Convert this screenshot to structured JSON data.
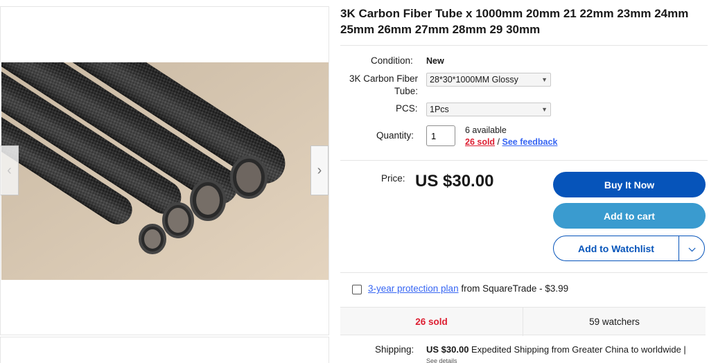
{
  "title": "3K Carbon Fiber Tube x 1000mm 20mm 21 22mm 23mm 24mm 25mm 26mm 27mm 28mm 29 30mm",
  "gallery": {
    "prev_icon": "chevron-left-icon",
    "next_icon": "chevron-right-icon",
    "prev": "‹",
    "next": "›"
  },
  "condition": {
    "label": "Condition:",
    "value": "New"
  },
  "variation": {
    "label_line1": "3K Carbon Fiber",
    "label_line2": "Tube:",
    "selected": "28*30*1000MM Glossy"
  },
  "pcs": {
    "label": "PCS:",
    "selected": "1Pcs"
  },
  "quantity": {
    "label": "Quantity:",
    "value": "1",
    "available": "6 available",
    "sold": "26 sold",
    "separator": " / ",
    "feedback": "See feedback"
  },
  "price": {
    "label": "Price:",
    "value": "US $30.00"
  },
  "buttons": {
    "buy_now": "Buy It Now",
    "add_to_cart": "Add to cart",
    "add_to_watchlist": "Add to Watchlist",
    "watch_chevron": "⌵"
  },
  "protection": {
    "link": "3-year protection plan",
    "rest": " from SquareTrade - $3.99"
  },
  "stats": {
    "sold": "26 sold",
    "watchers": "59 watchers"
  },
  "shipping": {
    "label": "Shipping:",
    "amount": "US $30.00",
    "detail": " Expedited Shipping from Greater China to worldwide |",
    "see_details": "See details"
  },
  "colors": {
    "buy_now": "#0654ba",
    "add_to_cart": "#3a9bcf",
    "sold": "#dd1e31",
    "link": "#3665f3"
  }
}
